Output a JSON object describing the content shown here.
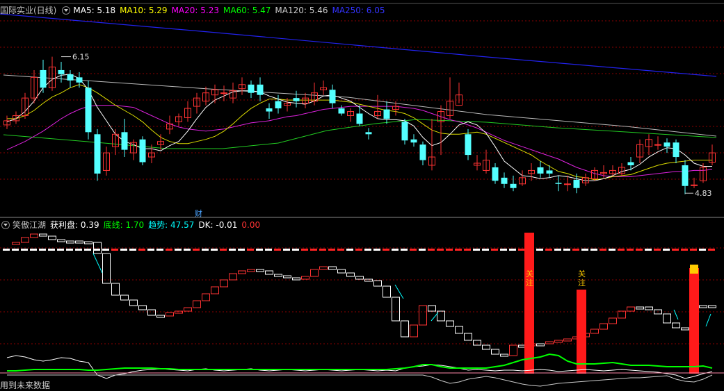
{
  "main_panel": {
    "title": "国际实业(日线)",
    "ma": [
      {
        "label": "MA5: 5.18",
        "color": "#ffffff"
      },
      {
        "label": "MA10: 5.29",
        "color": "#ffff00"
      },
      {
        "label": "MA20: 5.23",
        "color": "#ff00ff"
      },
      {
        "label": "MA60: 5.47",
        "color": "#00ff00"
      },
      {
        "label": "MA120: 5.46",
        "color": "#cccccc"
      },
      {
        "label": "MA250: 6.05",
        "color": "#3333ff"
      }
    ],
    "high_label": "6.15",
    "low_label": "4.83",
    "event_marker": "财"
  },
  "sub_panel": {
    "title": "笑傲江湖",
    "items": [
      {
        "label": "获利盘: 0.39",
        "color": "#ffffff"
      },
      {
        "label": "底线: 1.70",
        "color": "#00ff00"
      },
      {
        "label": "趋势: 47.57",
        "color": "#00ffff"
      },
      {
        "label": "DK: -0.01",
        "color": "#ffffff"
      },
      {
        "label": "0.00",
        "color": "#ff3333"
      }
    ],
    "bar_labels": [
      "关注",
      "关注"
    ]
  },
  "footer": "用到未来数据",
  "colors": {
    "up": "#ff3333",
    "down": "#54ffff",
    "grid": "#8b0000",
    "white": "#ffffff",
    "green_line": "#00ff00"
  },
  "chart_data": {
    "type": "candlestick",
    "price_range": [
      4.7,
      6.5
    ],
    "candles": [
      [
        5.49,
        5.53,
        5.58,
        5.45
      ],
      [
        5.53,
        5.58,
        5.62,
        5.5
      ],
      [
        5.58,
        5.75,
        5.8,
        5.55
      ],
      [
        5.75,
        5.95,
        6.02,
        5.7
      ],
      [
        6.02,
        5.85,
        6.12,
        5.8
      ],
      [
        5.85,
        6.05,
        6.15,
        5.82
      ],
      [
        6.02,
        5.98,
        6.1,
        5.9
      ],
      [
        5.98,
        5.92,
        6.02,
        5.85
      ],
      [
        5.95,
        5.9,
        6.0,
        5.85
      ],
      [
        5.85,
        5.42,
        5.92,
        5.35
      ],
      [
        5.4,
        5.02,
        5.45,
        4.95
      ],
      [
        5.05,
        5.22,
        5.28,
        5.0
      ],
      [
        5.28,
        5.4,
        5.45,
        5.2
      ],
      [
        5.42,
        5.25,
        5.55,
        5.18
      ],
      [
        5.22,
        5.32,
        5.35,
        5.15
      ],
      [
        5.35,
        5.13,
        5.38,
        5.1
      ],
      [
        5.18,
        5.22,
        5.3,
        5.12
      ],
      [
        5.3,
        5.33,
        5.4,
        5.25
      ],
      [
        5.45,
        5.5,
        5.58,
        5.4
      ],
      [
        5.52,
        5.57,
        5.6,
        5.48
      ],
      [
        5.56,
        5.65,
        5.72,
        5.52
      ],
      [
        5.67,
        5.75,
        5.8,
        5.6
      ],
      [
        5.72,
        5.8,
        5.86,
        5.68
      ],
      [
        5.78,
        5.83,
        5.88,
        5.7
      ],
      [
        5.8,
        5.8,
        5.87,
        5.72
      ],
      [
        5.75,
        5.82,
        5.9,
        5.7
      ],
      [
        5.84,
        5.88,
        5.95,
        5.78
      ],
      [
        5.88,
        5.8,
        5.92,
        5.75
      ],
      [
        5.88,
        5.78,
        5.95,
        5.72
      ],
      [
        5.65,
        5.62,
        5.7,
        5.55
      ],
      [
        5.72,
        5.65,
        5.78,
        5.6
      ],
      [
        5.68,
        5.7,
        5.75,
        5.62
      ],
      [
        5.75,
        5.72,
        5.82,
        5.66
      ],
      [
        5.7,
        5.75,
        5.8,
        5.65
      ],
      [
        5.72,
        5.8,
        5.9,
        5.68
      ],
      [
        5.83,
        5.85,
        5.92,
        5.78
      ],
      [
        5.83,
        5.7,
        5.88,
        5.65
      ],
      [
        5.65,
        5.6,
        5.68,
        5.58
      ],
      [
        5.58,
        5.62,
        5.65,
        5.52
      ],
      [
        5.6,
        5.5,
        5.68,
        5.48
      ],
      [
        5.42,
        5.4,
        5.46,
        5.35
      ],
      [
        5.58,
        5.62,
        5.78,
        5.55
      ],
      [
        5.64,
        5.55,
        5.72,
        5.5
      ],
      [
        5.64,
        5.67,
        5.72,
        5.58
      ],
      [
        5.52,
        5.34,
        5.55,
        5.3
      ],
      [
        5.35,
        5.32,
        5.4,
        5.28
      ],
      [
        5.3,
        5.15,
        5.33,
        5.1
      ],
      [
        5.1,
        5.18,
        5.55,
        5.05
      ],
      [
        5.52,
        5.62,
        5.68,
        5.2
      ],
      [
        5.58,
        5.72,
        5.95,
        5.55
      ],
      [
        5.68,
        5.78,
        5.9,
        5.7
      ],
      [
        5.4,
        5.2,
        5.45,
        5.15
      ],
      [
        5.1,
        5.12,
        5.2,
        5.05
      ],
      [
        5.05,
        5.15,
        5.25,
        5.02
      ],
      [
        5.08,
        4.95,
        5.12,
        4.92
      ],
      [
        4.98,
        4.92,
        5.03,
        4.88
      ],
      [
        4.92,
        4.88,
        5.0,
        4.85
      ],
      [
        4.92,
        4.98,
        5.05,
        4.9
      ],
      [
        5.02,
        5.05,
        5.12,
        4.95
      ],
      [
        5.08,
        5.02,
        5.14,
        4.98
      ],
      [
        5.05,
        5.02,
        5.1,
        4.98
      ],
      [
        4.93,
        4.92,
        5.0,
        4.85
      ],
      [
        4.92,
        4.92,
        5.0,
        4.85
      ],
      [
        4.96,
        4.88,
        5.02,
        4.83
      ],
      [
        4.93,
        4.98,
        5.02,
        4.9
      ],
      [
        4.97,
        5.05,
        5.08,
        4.95
      ],
      [
        5.02,
        5.03,
        5.1,
        4.98
      ],
      [
        5.02,
        5.05,
        5.1,
        5.0
      ],
      [
        5.02,
        5.08,
        5.12,
        5.0
      ],
      [
        5.13,
        5.1,
        5.18,
        5.05
      ],
      [
        5.18,
        5.3,
        5.35,
        5.12
      ],
      [
        5.28,
        5.35,
        5.4,
        5.2
      ],
      [
        5.3,
        5.3,
        5.38,
        5.25
      ],
      [
        5.32,
        5.28,
        5.36,
        5.22
      ],
      [
        5.32,
        5.18,
        5.35,
        5.12
      ],
      [
        5.1,
        4.9,
        5.15,
        4.82
      ],
      [
        4.91,
        4.91,
        4.98,
        4.88
      ],
      [
        4.95,
        5.08,
        5.12,
        4.93
      ],
      [
        5.13,
        5.22,
        5.3,
        5.1
      ]
    ],
    "ma5": [
      5.52,
      5.55,
      5.62,
      5.72,
      5.85,
      5.93,
      5.97,
      5.98,
      5.94,
      5.83,
      5.66,
      5.53,
      5.4,
      5.33,
      5.3,
      5.26,
      5.26,
      5.24,
      5.29,
      5.33,
      5.43,
      5.55,
      5.66,
      5.73,
      5.77,
      5.81,
      5.82,
      5.82,
      5.81,
      5.77,
      5.74,
      5.71,
      5.7,
      5.69,
      5.72,
      5.77,
      5.78,
      5.75,
      5.72,
      5.66,
      5.6,
      5.55,
      5.54,
      5.54,
      5.53,
      5.48,
      5.37,
      5.29,
      5.32,
      5.4,
      5.49,
      5.52,
      5.49,
      5.41,
      5.28,
      5.14,
      5.07,
      5.0,
      4.99,
      4.97,
      4.98,
      5.0,
      4.99,
      4.97,
      4.95,
      4.95,
      4.97,
      5.0,
      5.04,
      5.06,
      5.11,
      5.18,
      5.23,
      5.27,
      5.26,
      5.2,
      5.12,
      5.09,
      5.09
    ],
    "ma10": [
      5.55,
      5.55,
      5.58,
      5.63,
      5.7,
      5.76,
      5.8,
      5.85,
      5.88,
      5.85,
      5.8,
      5.74,
      5.68,
      5.63,
      5.58,
      5.52,
      5.44,
      5.37,
      5.33,
      5.31,
      5.31,
      5.33,
      5.35,
      5.38,
      5.43,
      5.5,
      5.58,
      5.65,
      5.7,
      5.74,
      5.74,
      5.73,
      5.73,
      5.73,
      5.73,
      5.73,
      5.73,
      5.72,
      5.71,
      5.69,
      5.67,
      5.65,
      5.63,
      5.62,
      5.6,
      5.56,
      5.5,
      5.44,
      5.41,
      5.4,
      5.4,
      5.41,
      5.42,
      5.4,
      5.36,
      5.32,
      5.28,
      5.24,
      5.2,
      5.14,
      5.09,
      5.04,
      5.02,
      4.99,
      4.98,
      4.96,
      4.97,
      4.99,
      5.0,
      5.01,
      5.04,
      5.07,
      5.1,
      5.12,
      5.13,
      5.14,
      5.15,
      5.15,
      5.15
    ],
    "ma20": [
      5.25,
      5.29,
      5.33,
      5.38,
      5.43,
      5.49,
      5.55,
      5.6,
      5.64,
      5.67,
      5.68,
      5.68,
      5.68,
      5.67,
      5.66,
      5.62,
      5.58,
      5.54,
      5.5,
      5.47,
      5.45,
      5.44,
      5.43,
      5.44,
      5.45,
      5.47,
      5.49,
      5.51,
      5.52,
      5.53,
      5.55,
      5.57,
      5.58,
      5.6,
      5.62,
      5.64,
      5.65,
      5.66,
      5.67,
      5.67,
      5.67,
      5.67,
      5.67,
      5.67,
      5.66,
      5.65,
      5.63,
      5.6,
      5.57,
      5.54,
      5.52,
      5.49,
      5.46,
      5.42,
      5.38,
      5.34,
      5.31,
      5.28,
      5.25,
      5.22,
      5.19,
      5.16,
      5.12,
      5.08,
      5.05,
      5.02,
      5.0,
      4.99,
      4.99,
      4.99,
      5.0,
      5.01,
      5.02,
      5.03,
      5.04,
      5.04,
      5.05,
      5.05,
      5.06
    ]
  }
}
